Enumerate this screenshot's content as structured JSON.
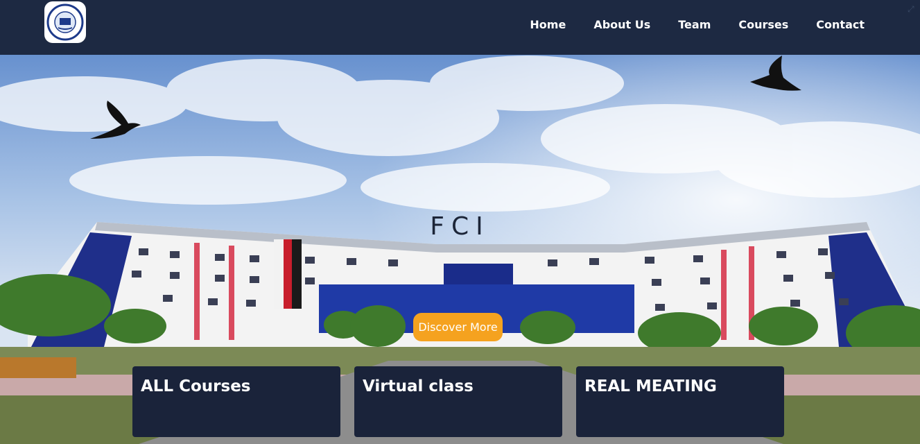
{
  "nav": {
    "logo_alt": "Suez Canal University",
    "items": [
      "Home",
      "About Us",
      "Team",
      "Courses",
      "Contact"
    ]
  },
  "hero": {
    "title": "FCI",
    "cta_label": "Discover More"
  },
  "cards": [
    "ALL Courses",
    "Virtual class",
    "REAL MEATING"
  ],
  "colors": {
    "navbar": "#1d2942",
    "accent": "#f5a21f",
    "card": "#1a233a",
    "sky": "#5a85c8",
    "building_blue": "#1f2f8a"
  },
  "icons": {
    "corner": "expand-icon"
  }
}
